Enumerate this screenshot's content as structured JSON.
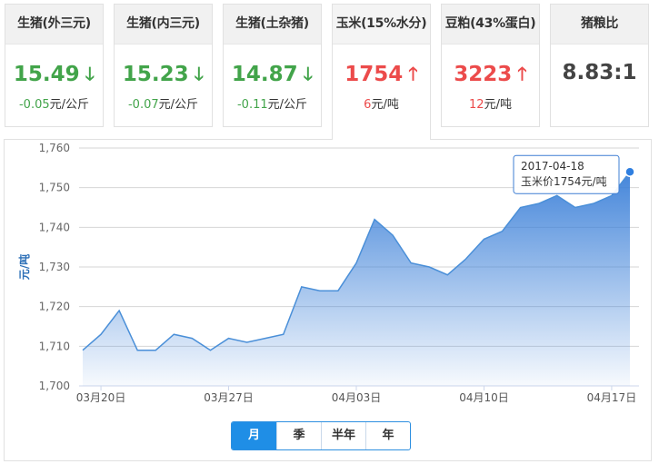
{
  "cards": [
    {
      "title": "生猪(外三元)",
      "price": "15.49",
      "direction": "down",
      "change": "-0.05",
      "unit": "元/公斤"
    },
    {
      "title": "生猪(内三元)",
      "price": "15.23",
      "direction": "down",
      "change": "-0.07",
      "unit": "元/公斤"
    },
    {
      "title": "生猪(土杂猪)",
      "price": "14.87",
      "direction": "down",
      "change": "-0.11",
      "unit": "元/公斤"
    },
    {
      "title": "玉米(15%水分)",
      "price": "1754",
      "direction": "up",
      "change": "6",
      "unit": "元/吨"
    },
    {
      "title": "豆粕(43%蛋白)",
      "price": "3223",
      "direction": "up",
      "change": "12",
      "unit": "元/吨"
    },
    {
      "title": "猪粮比",
      "price": "8.83:1",
      "direction": "none",
      "change": "",
      "unit": ""
    }
  ],
  "arrows": {
    "down": "🡓",
    "up": "🡑"
  },
  "colors": {
    "down": "#42a44a",
    "up": "#ec4b4b",
    "line": "#4a8fd8",
    "accent": "#1f8ee6"
  },
  "chart_data": {
    "type": "area",
    "ylabel": "元/吨",
    "xlabel": "",
    "ylim": [
      1700,
      1760
    ],
    "yticks": [
      1700,
      1710,
      1720,
      1730,
      1740,
      1750,
      1760
    ],
    "ytick_labels": [
      "1,700",
      "1,710",
      "1,720",
      "1,730",
      "1,740",
      "1,750",
      "1,760"
    ],
    "x_tick_labels": [
      {
        "date": "2017-03-20",
        "label": "03月20日"
      },
      {
        "date": "2017-03-27",
        "label": "03月27日"
      },
      {
        "date": "2017-04-03",
        "label": "04月03日"
      },
      {
        "date": "2017-04-10",
        "label": "04月10日"
      },
      {
        "date": "2017-04-17",
        "label": "04月17日"
      }
    ],
    "series": [
      {
        "points": [
          [
            "2017-03-19",
            1709
          ],
          [
            "2017-03-20",
            1713
          ],
          [
            "2017-03-21",
            1719
          ],
          [
            "2017-03-22",
            1709
          ],
          [
            "2017-03-23",
            1709
          ],
          [
            "2017-03-24",
            1713
          ],
          [
            "2017-03-25",
            1712
          ],
          [
            "2017-03-26",
            1709
          ],
          [
            "2017-03-27",
            1712
          ],
          [
            "2017-03-28",
            1711
          ],
          [
            "2017-03-29",
            1712
          ],
          [
            "2017-03-30",
            1713
          ],
          [
            "2017-03-31",
            1725
          ],
          [
            "2017-04-01",
            1724
          ],
          [
            "2017-04-02",
            1724
          ],
          [
            "2017-04-03",
            1731
          ],
          [
            "2017-04-04",
            1742
          ],
          [
            "2017-04-05",
            1738
          ],
          [
            "2017-04-06",
            1731
          ],
          [
            "2017-04-07",
            1730
          ],
          [
            "2017-04-08",
            1728
          ],
          [
            "2017-04-09",
            1732
          ],
          [
            "2017-04-10",
            1737
          ],
          [
            "2017-04-11",
            1739
          ],
          [
            "2017-04-12",
            1745
          ],
          [
            "2017-04-13",
            1746
          ],
          [
            "2017-04-14",
            1748
          ],
          [
            "2017-04-15",
            1745
          ],
          [
            "2017-04-16",
            1746
          ],
          [
            "2017-04-17",
            1748
          ],
          [
            "2017-04-18",
            1754
          ]
        ]
      }
    ],
    "grid": true,
    "tooltip": {
      "date": "2017-04-18",
      "text": "玉米价1754元/吨"
    }
  },
  "range_tabs": [
    {
      "label": "月",
      "active": true
    },
    {
      "label": "季",
      "active": false
    },
    {
      "label": "半年",
      "active": false
    },
    {
      "label": "年",
      "active": false
    }
  ]
}
